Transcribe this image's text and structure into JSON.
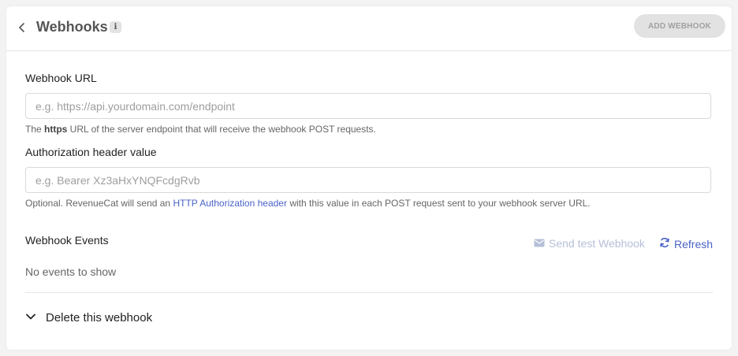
{
  "header": {
    "title": "Webhooks",
    "info_glyph": "i",
    "add_button_label": "ADD WEBHOOK"
  },
  "form": {
    "url": {
      "label": "Webhook URL",
      "placeholder": "e.g. https://api.yourdomain.com/endpoint",
      "value": "",
      "help_prefix": "The ",
      "help_bold": "https",
      "help_suffix": " URL of the server endpoint that will receive the webhook POST requests."
    },
    "auth": {
      "label": "Authorization header value",
      "placeholder": "e.g. Bearer Xz3aHxYNQFcdgRvb",
      "value": "",
      "help_prefix": "Optional. RevenueCat will send an ",
      "help_link": "HTTP Authorization header",
      "help_suffix": " with this value in each POST request sent to your webhook server URL."
    }
  },
  "events": {
    "label": "Webhook Events",
    "send_test_label": "Send test Webhook",
    "refresh_label": "Refresh",
    "empty_text": "No events to show"
  },
  "danger": {
    "delete_label": "Delete this webhook"
  },
  "colors": {
    "link": "#4a63c7",
    "disabled_link": "#b6bfd7",
    "disabled_button_bg": "#e2e2e2"
  },
  "icons": {
    "back": "chevron-left-icon",
    "info": "info-icon",
    "send_test": "envelope-icon",
    "refresh": "refresh-icon",
    "expand": "chevron-down-icon"
  }
}
